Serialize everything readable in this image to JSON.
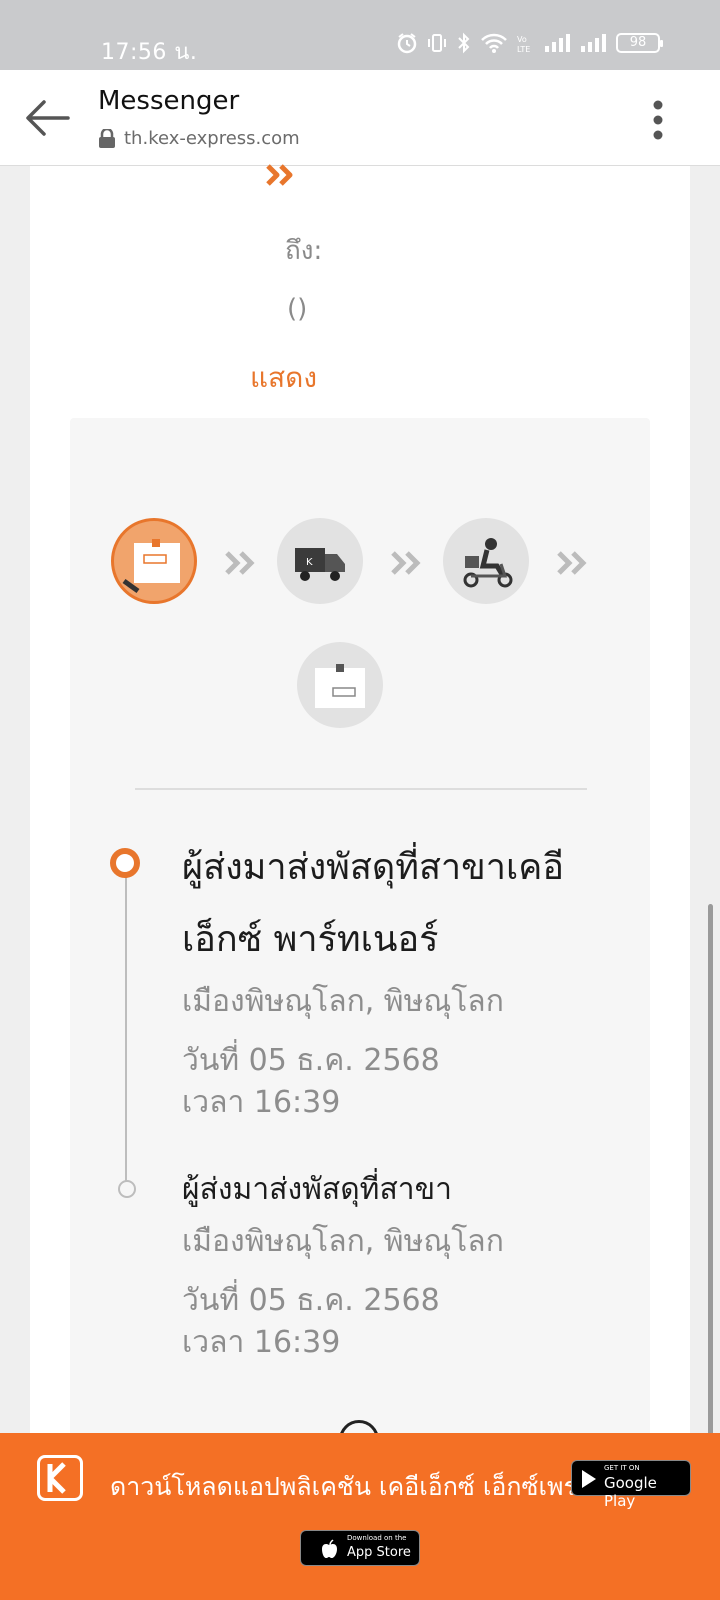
{
  "status_bar": {
    "time": "17:56 น.",
    "battery": "98",
    "icons": [
      "alarm-icon",
      "vibrate-icon",
      "bluetooth-icon",
      "wifi-icon",
      "volte-icon",
      "signal-icon",
      "signal-icon",
      "battery-icon"
    ]
  },
  "header": {
    "title": "Messenger",
    "url": "th.kex-express.com"
  },
  "shipment": {
    "to_label": "ถึง:",
    "to_value": "()",
    "show_link": "แสดง"
  },
  "steps": [
    {
      "name": "parcel-drop-off",
      "active": true
    },
    {
      "name": "in-transit-truck",
      "active": false
    },
    {
      "name": "out-for-delivery",
      "active": false
    },
    {
      "name": "delivered",
      "active": false
    }
  ],
  "timeline": [
    {
      "title_line1": "ผู้ส่งมาส่งพัสดุที่สาขาเคอี",
      "title_line2": "เอ็กซ์ พาร์ทเนอร์",
      "place": "เมืองพิษณุโลก, พิษณุโลก",
      "date": "วันที่ 05 ธ.ค. 2568",
      "time": "เวลา 16:39"
    },
    {
      "title_line1": "ผู้ส่งมาส่งพัสดุที่สาขา",
      "place": "เมืองพิษณุโลก, พิษณุโลก",
      "date": "วันที่ 05 ธ.ค. 2568",
      "time": "เวลา 16:39"
    }
  ],
  "banner": {
    "text": "ดาวน์โหลดแอปพลิเคชัน เคอีเอ็กซ์ เอ็กซ์เพรส",
    "google_play_small": "GET IT ON",
    "google_play_big": "Google Play",
    "app_store_small": "Download on the",
    "app_store_big": "App Store"
  },
  "colors": {
    "accent": "#e8762c",
    "banner": "#f47025"
  }
}
